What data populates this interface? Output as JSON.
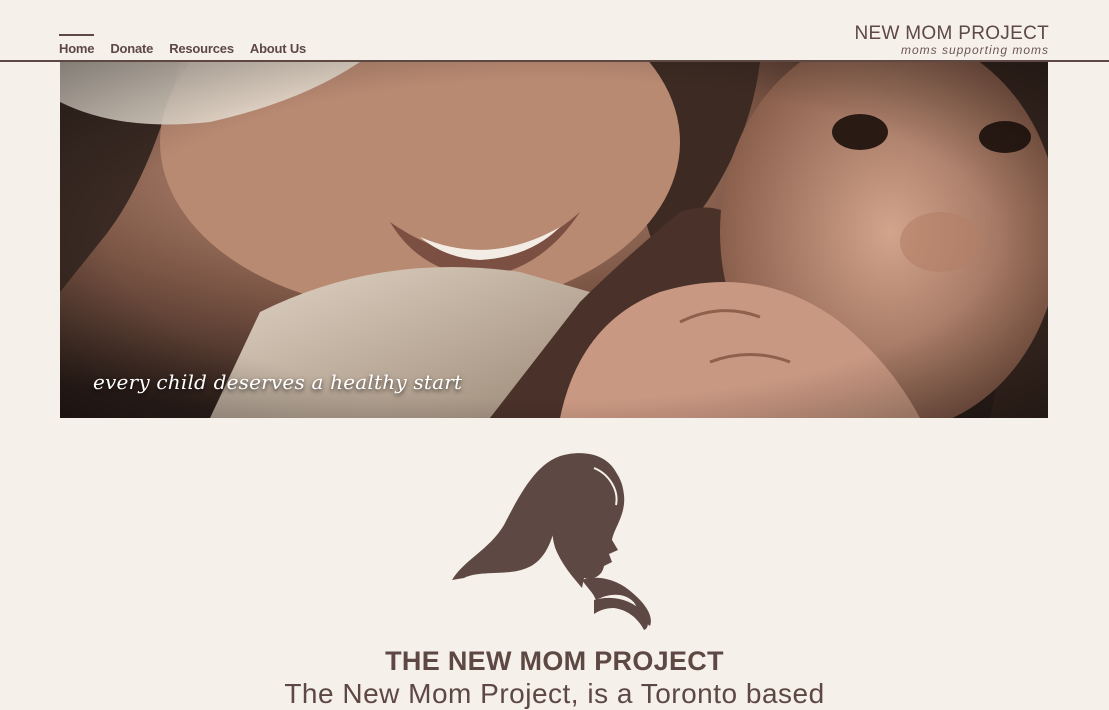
{
  "nav": {
    "items": [
      {
        "label": "Home",
        "active": true
      },
      {
        "label": "Donate"
      },
      {
        "label": "Resources"
      },
      {
        "label": "About Us"
      }
    ]
  },
  "logo": {
    "title": "NEW MOM PROJECT",
    "tagline": "moms supporting moms"
  },
  "hero": {
    "caption": "every child deserves a healthy start",
    "image": "mother-and-baby-photo"
  },
  "emblem": {
    "icon": "mother-child-silhouette-icon",
    "color": "#5e4843"
  },
  "main": {
    "title": "THE NEW MOM PROJECT",
    "intro": "The New Mom Project, is a Toronto based"
  },
  "colors": {
    "background": "#f5f0ea",
    "brand": "#5e4843"
  }
}
